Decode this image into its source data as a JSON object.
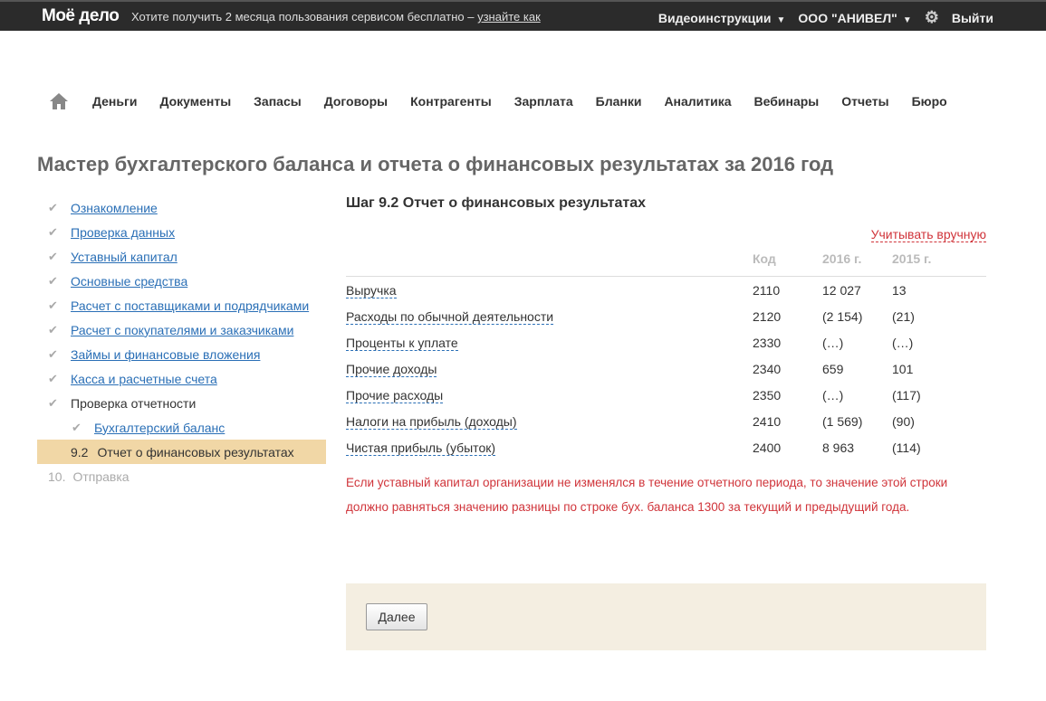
{
  "topbar": {
    "logo": "Моё дело",
    "promo": "Хотите получить 2 месяца пользования сервисом бесплатно –",
    "promo_link": "узнайте как",
    "video": "Видеоинструкции",
    "company": "ООО \"АНИВЕЛ\"",
    "logout": "Выйти"
  },
  "nav": [
    "Деньги",
    "Документы",
    "Запасы",
    "Договоры",
    "Контрагенты",
    "Зарплата",
    "Бланки",
    "Аналитика",
    "Вебинары",
    "Отчеты",
    "Бюро"
  ],
  "title": "Мастер бухгалтерского баланса и отчета о финансовых результатах за 2016 год",
  "steps": [
    "Ознакомление",
    "Проверка данных",
    "Уставный капитал",
    "Основные средства",
    "Расчет с поставщиками и подрядчиками",
    "Расчет с покупателями и заказчиками",
    "Займы и финансовые вложения",
    "Касса и расчетные счета"
  ],
  "check_step": "Проверка отчетности",
  "sub_done": "Бухгалтерский баланс",
  "active": {
    "num": "9.2",
    "label": "Отчет о финансовых результатах"
  },
  "next_step": {
    "num": "10.",
    "label": "Отправка"
  },
  "main": {
    "heading": "Шаг 9.2 Отчет о финансовых результатах",
    "manual": "Учитывать вручную",
    "headers": {
      "code": "Код",
      "y1": "2016 г.",
      "y2": "2015 г."
    },
    "rows": [
      {
        "name": "Выручка",
        "code": "2110",
        "y1": "12 027",
        "y2": "13"
      },
      {
        "name": "Расходы по обычной деятельности",
        "code": "2120",
        "y1": "(2 154)",
        "y2": "(21)"
      },
      {
        "name": "Проценты к уплате",
        "code": "2330",
        "y1": "(…)",
        "y2": "(…)"
      },
      {
        "name": "Прочие доходы",
        "code": "2340",
        "y1": "659",
        "y2": "101"
      },
      {
        "name": "Прочие расходы",
        "code": "2350",
        "y1": "(…)",
        "y2": "(117)"
      },
      {
        "name": "Налоги на прибыль (доходы)",
        "code": "2410",
        "y1": "(1 569)",
        "y2": "(90)"
      },
      {
        "name": "Чистая прибыль (убыток)",
        "code": "2400",
        "y1": "8 963",
        "y2": "(114)"
      }
    ],
    "warning": "Если уставный капитал организации не изменялся в течение отчетного периода, то значение этой строки должно равняться значению разницы по строке бух. баланса 1300 за текущий и предыдущий года.",
    "next": "Далее"
  }
}
